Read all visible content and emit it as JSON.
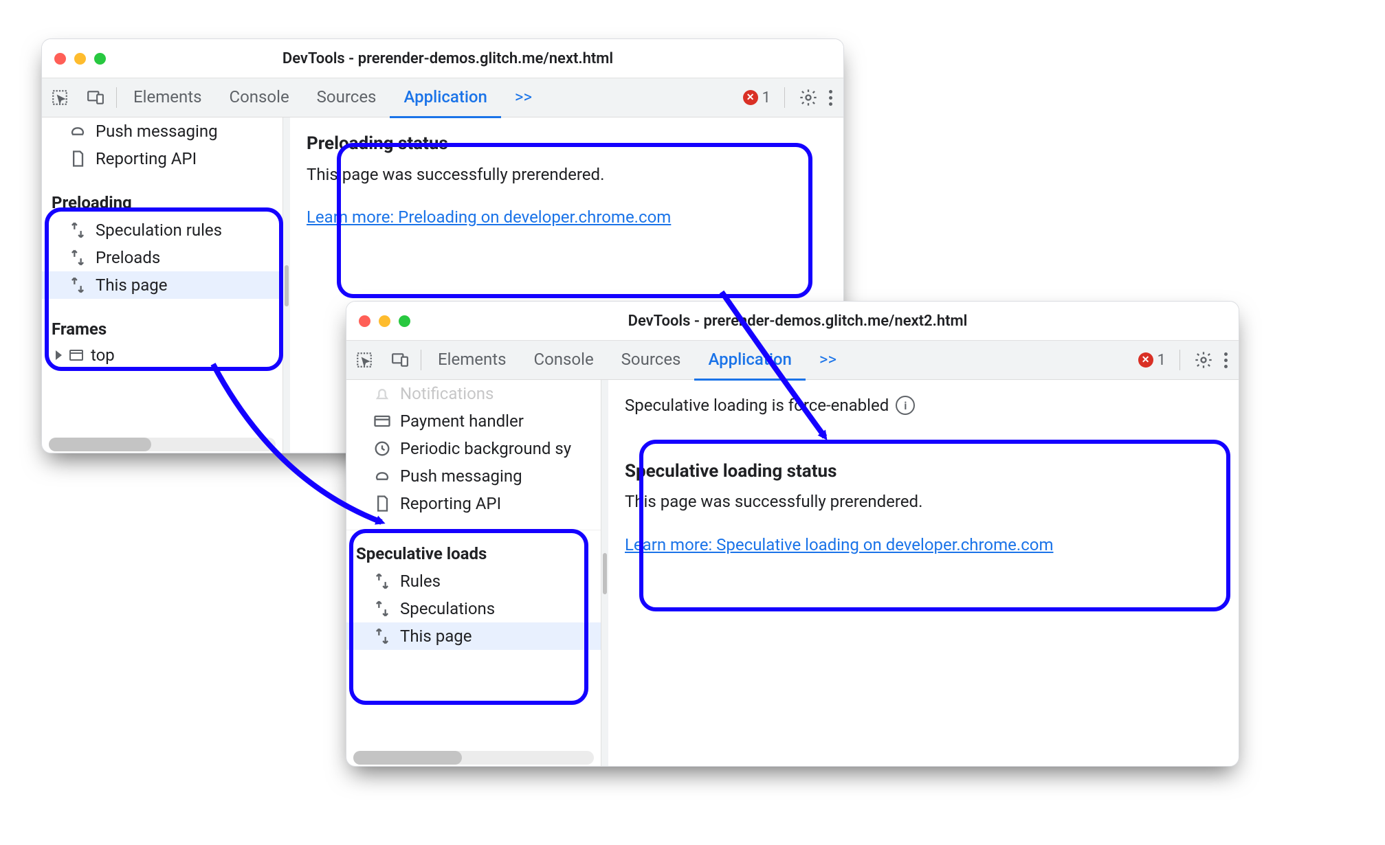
{
  "win1": {
    "title": "DevTools - prerender-demos.glitch.me/next.html",
    "tabs": {
      "elements": "Elements",
      "console": "Console",
      "sources": "Sources",
      "application": "Application"
    },
    "more_label": ">>",
    "error_count": "1",
    "sidebar": {
      "items_above": {
        "push": "Push messaging",
        "reporting": "Reporting API"
      },
      "section": "Preloading",
      "items": {
        "rules": "Speculation rules",
        "preloads": "Preloads",
        "thispage": "This page"
      },
      "frames": "Frames",
      "top": "top"
    },
    "content": {
      "heading": "Preloading status",
      "body": "This page was successfully prerendered.",
      "link": "Learn more: Preloading on developer.chrome.com"
    }
  },
  "win2": {
    "title": "DevTools - prerender-demos.glitch.me/next2.html",
    "tabs": {
      "elements": "Elements",
      "console": "Console",
      "sources": "Sources",
      "application": "Application"
    },
    "more_label": ">>",
    "error_count": "1",
    "sidebar": {
      "items_above": {
        "notifications": "Notifications",
        "payment": "Payment handler",
        "periodic": "Periodic background sy",
        "push": "Push messaging",
        "reporting": "Reporting API"
      },
      "section": "Speculative loads",
      "items": {
        "rules": "Rules",
        "speculations": "Speculations",
        "thispage": "This page"
      }
    },
    "banner": "Speculative loading is force-enabled",
    "content": {
      "heading": "Speculative loading status",
      "body": "This page was successfully prerendered.",
      "link": "Learn more: Speculative loading on developer.chrome.com"
    }
  }
}
